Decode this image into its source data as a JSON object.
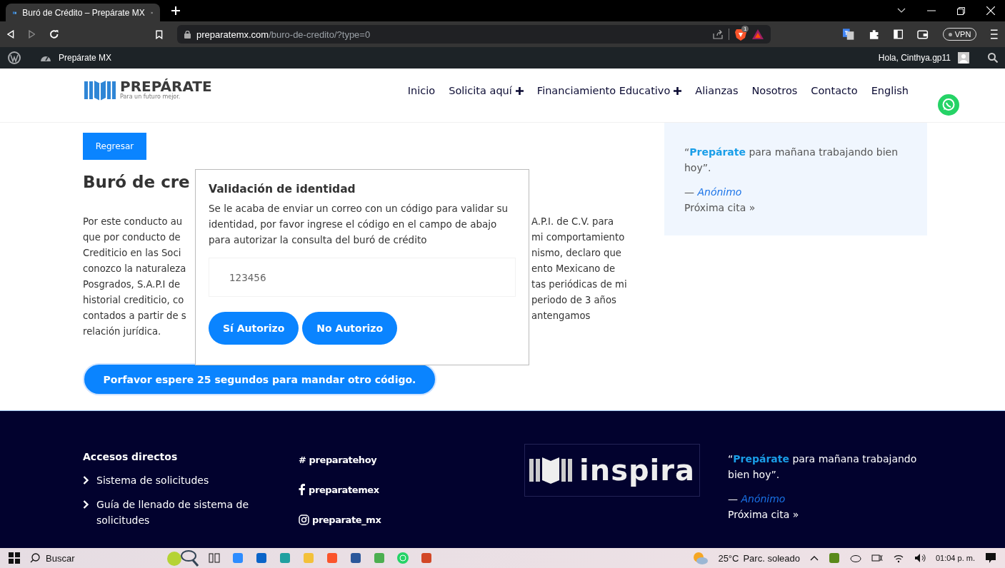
{
  "browser": {
    "tab_title": "Buró de Crédito – Prepárate MX",
    "url_host": "preparatemx.com",
    "url_path": "/buro-de-credito/?type=0",
    "vpn_label": "VPN",
    "extension_badge": "1"
  },
  "admin_bar": {
    "site_name": "Prepárate MX",
    "greeting": "Hola, Cinthya.gp11"
  },
  "site_header": {
    "logo_name": "PREPÁRATE",
    "logo_tagline": "Para un futuro mejor.",
    "nav": [
      {
        "label": "Inicio",
        "has_submenu": false
      },
      {
        "label": "Solicita aquí",
        "has_submenu": true
      },
      {
        "label": "Financiamiento Educativo",
        "has_submenu": true
      },
      {
        "label": "Alianzas",
        "has_submenu": false
      },
      {
        "label": "Nosotros",
        "has_submenu": false
      },
      {
        "label": "Contacto",
        "has_submenu": false
      },
      {
        "label": "English",
        "has_submenu": false
      }
    ]
  },
  "main": {
    "back_button": "Regresar",
    "heading": "Buró de cre",
    "paragraph_lines": [
      {
        "left": "Por este conducto au",
        "right": "A.P.I. de C.V. para"
      },
      {
        "left": "que por conducto de",
        "right": "mi comportamiento"
      },
      {
        "left": "Crediticio en las Soci",
        "right": "nismo, declaro que"
      },
      {
        "left": "conozco la naturaleza",
        "right": "ento Mexicano de"
      },
      {
        "left": "Posgrados, S.A.P.I de",
        "right": "tas periódicas de mi"
      },
      {
        "left": "historial crediticio, co",
        "right": "periodo de 3 años"
      },
      {
        "left": "contados a partir de s",
        "right": "antengamos"
      },
      {
        "left": "relación jurídica."
      }
    ],
    "wait_button": "Porfavor espere 25 segundos para mandar otro código."
  },
  "modal": {
    "title": "Validación de identidad",
    "message": "Se le acaba de enviar un correo con un código para validar su identidad, por favor ingrese el código en el campo de abajo para autorizar la consulta del buró de crédito",
    "code_field": {
      "value": "123456"
    },
    "buttons": [
      "Sí Autorizo",
      "No Autorizo"
    ]
  },
  "sidebar_quote": {
    "text": "“**Prepárate** para mañana trabajando bien hoy”.",
    "author": "— *Anónimo*",
    "next_link": "Próxima cita »"
  },
  "footer": {
    "heading": "Accesos directos",
    "links": [
      "Sistema de solicitudes",
      "Guía de llenado de sistema de solicitudes"
    ],
    "social": [
      {
        "kind": "hashtag",
        "label": "# preparatehoy"
      },
      {
        "kind": "facebook",
        "label": "preparatemex"
      },
      {
        "kind": "instagram",
        "label": "preparate_mx"
      }
    ],
    "logo_text": "inspira",
    "quote": {
      "text": "“**Prepárate** para mañana trabajando bien hoy”.",
      "author": "— *Anónimo*",
      "next_link": "Próxima cita »"
    }
  },
  "taskbar": {
    "search_placeholder": "Buscar",
    "temperature": "25°C",
    "weather": "Parc. soleado",
    "time": "01:04 p. m."
  }
}
